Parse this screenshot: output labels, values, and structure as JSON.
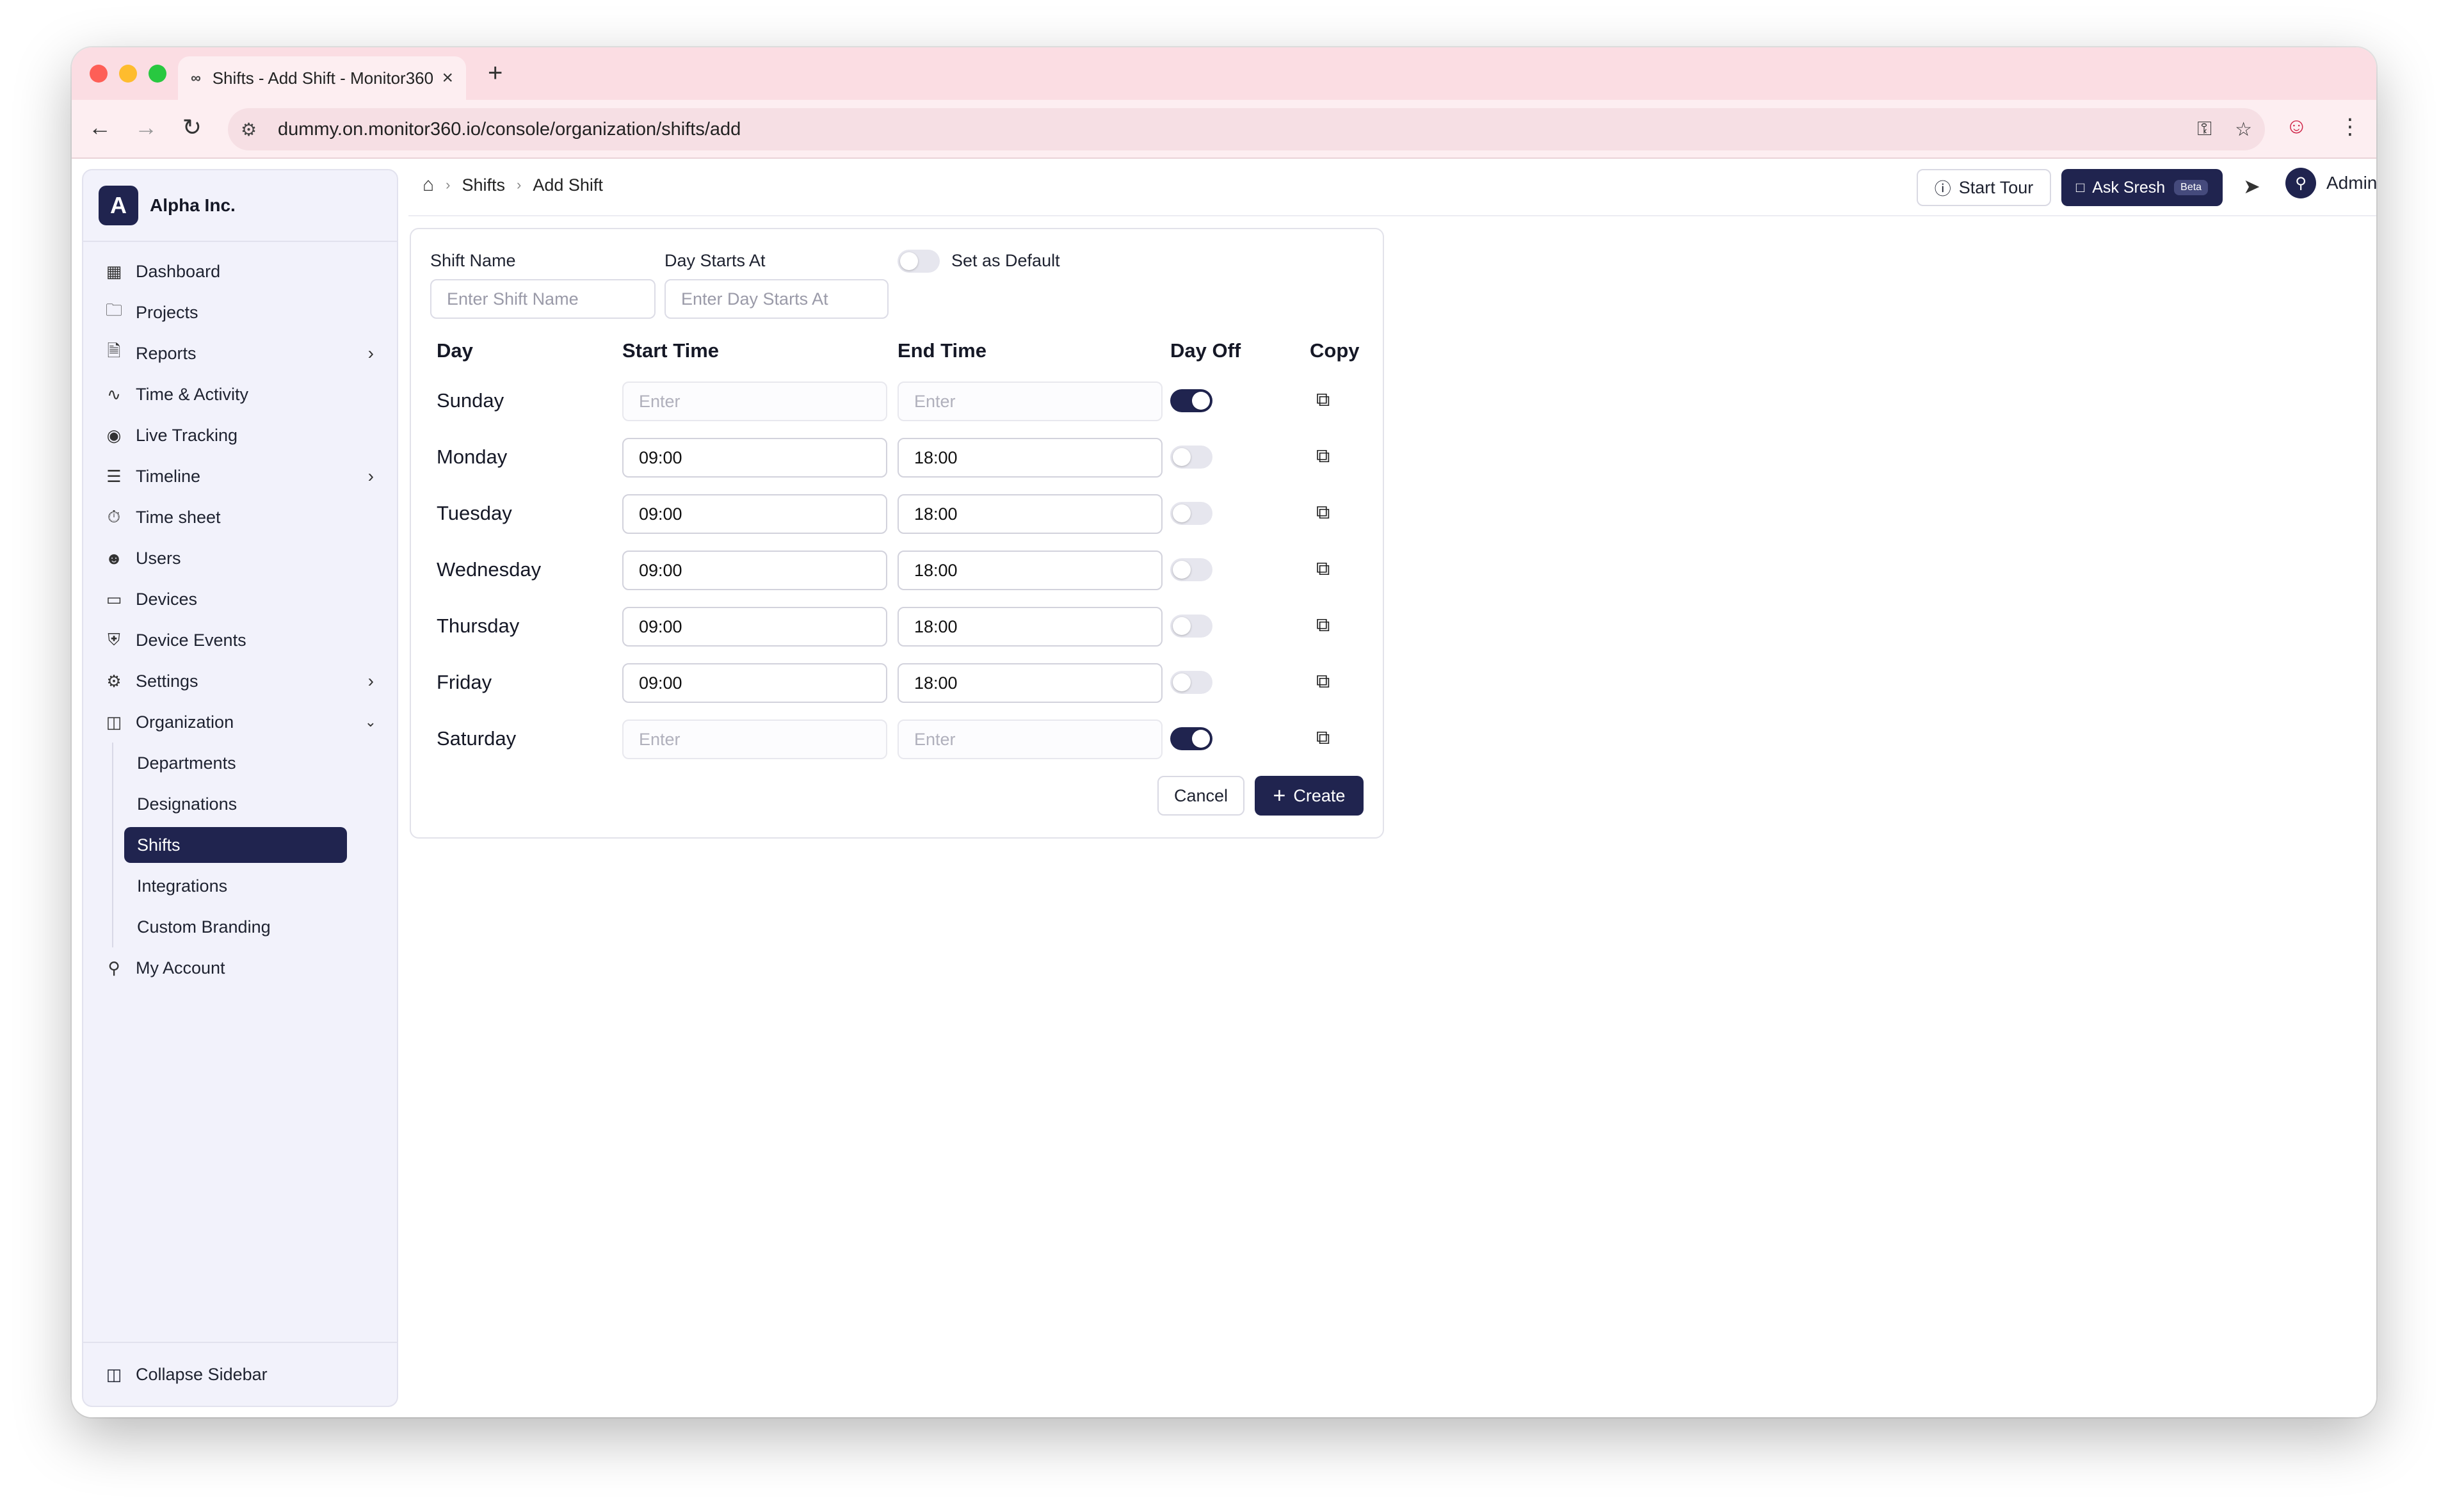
{
  "browser": {
    "tab_title": "Shifts - Add Shift - Monitor360",
    "url": "dummy.on.monitor360.io/console/organization/shifts/add",
    "traffic_colors": [
      "#fe5f57",
      "#febc2e",
      "#28c840"
    ]
  },
  "org": {
    "logo_letter": "A",
    "name": "Alpha Inc."
  },
  "sidebar": {
    "items": [
      {
        "label": "Dashboard",
        "icon": "dashboard-icon"
      },
      {
        "label": "Projects",
        "icon": "folder-icon"
      },
      {
        "label": "Reports",
        "icon": "report-icon",
        "expandable": true
      },
      {
        "label": "Time & Activity",
        "icon": "activity-icon"
      },
      {
        "label": "Live Tracking",
        "icon": "broadcast-icon"
      },
      {
        "label": "Timeline",
        "icon": "timeline-icon",
        "expandable": true
      },
      {
        "label": "Time sheet",
        "icon": "timer-icon"
      },
      {
        "label": "Users",
        "icon": "users-icon"
      },
      {
        "label": "Devices",
        "icon": "monitor-icon"
      },
      {
        "label": "Device Events",
        "icon": "shield-icon"
      },
      {
        "label": "Settings",
        "icon": "gear-icon",
        "expandable": true
      },
      {
        "label": "Organization",
        "icon": "building-icon",
        "expanded": true
      }
    ],
    "org_subitems": [
      "Departments",
      "Designations",
      "Shifts",
      "Integrations",
      "Custom Branding"
    ],
    "active_subitem": "Shifts",
    "account_label": "My Account",
    "collapse_label": "Collapse Sidebar"
  },
  "header": {
    "breadcrumb": [
      "Shifts",
      "Add Shift"
    ],
    "start_tour": "Start Tour",
    "ask": "Ask Sresh",
    "beta": "Beta",
    "user": "Admin"
  },
  "form": {
    "shift_name_label": "Shift Name",
    "shift_name_placeholder": "Enter Shift Name",
    "day_starts_label": "Day Starts At",
    "day_starts_placeholder": "Enter Day Starts At",
    "default_label": "Set as Default",
    "default_on": false
  },
  "table": {
    "headers": {
      "day": "Day",
      "start": "Start Time",
      "end": "End Time",
      "off": "Day Off",
      "copy": "Copy"
    },
    "time_placeholder": "Enter",
    "rows": [
      {
        "day": "Sunday",
        "start": "",
        "end": "",
        "off": true
      },
      {
        "day": "Monday",
        "start": "09:00",
        "end": "18:00",
        "off": false
      },
      {
        "day": "Tuesday",
        "start": "09:00",
        "end": "18:00",
        "off": false
      },
      {
        "day": "Wednesday",
        "start": "09:00",
        "end": "18:00",
        "off": false
      },
      {
        "day": "Thursday",
        "start": "09:00",
        "end": "18:00",
        "off": false
      },
      {
        "day": "Friday",
        "start": "09:00",
        "end": "18:00",
        "off": false
      },
      {
        "day": "Saturday",
        "start": "",
        "end": "",
        "off": true
      }
    ]
  },
  "actions": {
    "cancel": "Cancel",
    "create": "Create"
  }
}
